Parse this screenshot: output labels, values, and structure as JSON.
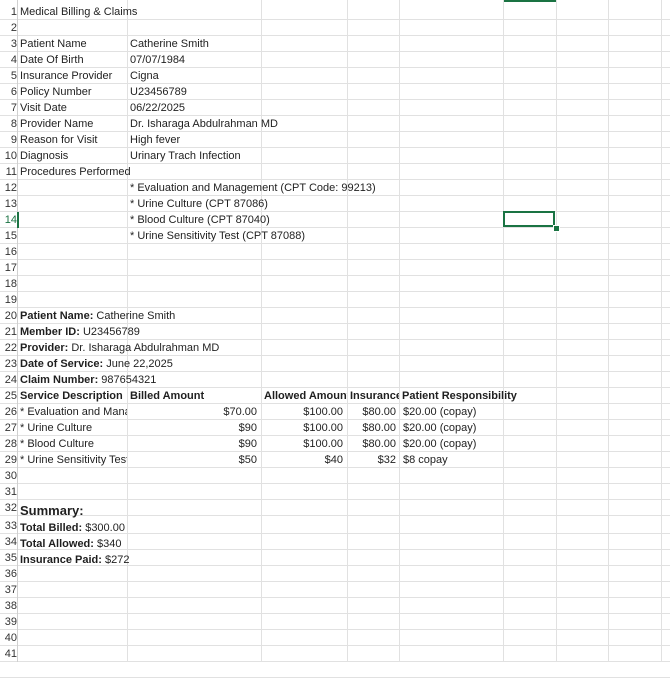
{
  "rows": [
    "1",
    "2",
    "3",
    "4",
    "5",
    "6",
    "7",
    "8",
    "9",
    "10",
    "11",
    "12",
    "13",
    "14",
    "15",
    "16",
    "17",
    "18",
    "19",
    "20",
    "21",
    "22",
    "23",
    "24",
    "25",
    "26",
    "27",
    "28",
    "29",
    "30",
    "31",
    "32",
    "33",
    "34",
    "35",
    "36",
    "37",
    "38",
    "39",
    "40",
    "41"
  ],
  "title": "Medical Billing & Claims",
  "patient_info": [
    {
      "label": "Patient Name",
      "value": "Catherine Smith"
    },
    {
      "label": "Date Of Birth",
      "value": "07/07/1984"
    },
    {
      "label": "Insurance Provider",
      "value": "Cigna"
    },
    {
      "label": "Policy Number",
      "value": "U23456789"
    },
    {
      "label": "Visit Date",
      "value": "06/22/2025"
    },
    {
      "label": "Provider Name",
      "value": "Dr. Isharaga Abdulrahman MD"
    },
    {
      "label": "Reason for Visit",
      "value": "High fever"
    },
    {
      "label": "Diagnosis",
      "value": "Urinary Trach Infection"
    },
    {
      "label": "Procedures Performed",
      "value": ""
    }
  ],
  "procedures": [
    "* Evaluation and Management (CPT Code: 99213)",
    "* Urine Culture (CPT 87086)",
    "* Blood Culture (CPT 87040)",
    "* Urine Sensitivity Test (CPT 87088)"
  ],
  "claim_header": [
    {
      "label": "Patient Name:",
      "value": " Catherine Smith"
    },
    {
      "label": "Member ID:",
      "value": " U23456789"
    },
    {
      "label": "Provider:",
      "value": " Dr. Isharaga Abdulrahman MD"
    },
    {
      "label": "Date of Service:",
      "value": " June 22,2025"
    },
    {
      "label": "Claim Number:",
      "value": " 987654321"
    }
  ],
  "table": {
    "headers": [
      "Service Description",
      "Billed Amount",
      "Allowed Amount",
      "Insurance",
      "Patient Responsibility"
    ],
    "rows": [
      [
        "* Evaluation and Management",
        "$70.00",
        "$100.00",
        "$80.00",
        "$20.00 (copay)"
      ],
      [
        "* Urine Culture",
        "$90",
        "$100.00",
        "$80.00",
        "$20.00 (copay)"
      ],
      [
        "* Blood Culture",
        "$90",
        "$100.00",
        "$80.00",
        "$20.00 (copay)"
      ],
      [
        "* Urine Sensitivity Test",
        "$50",
        "$40",
        "$32",
        "$8 copay"
      ]
    ]
  },
  "summary": {
    "heading": "Summary:",
    "items": [
      {
        "label": "Total Billed:",
        "value": " $300.00"
      },
      {
        "label": "Total Allowed:",
        "value": " $340"
      },
      {
        "label": "Insurance Paid:",
        "value": " $272"
      }
    ]
  },
  "colors": {
    "selection": "#1a7343",
    "grid": "#e1e1e1"
  }
}
